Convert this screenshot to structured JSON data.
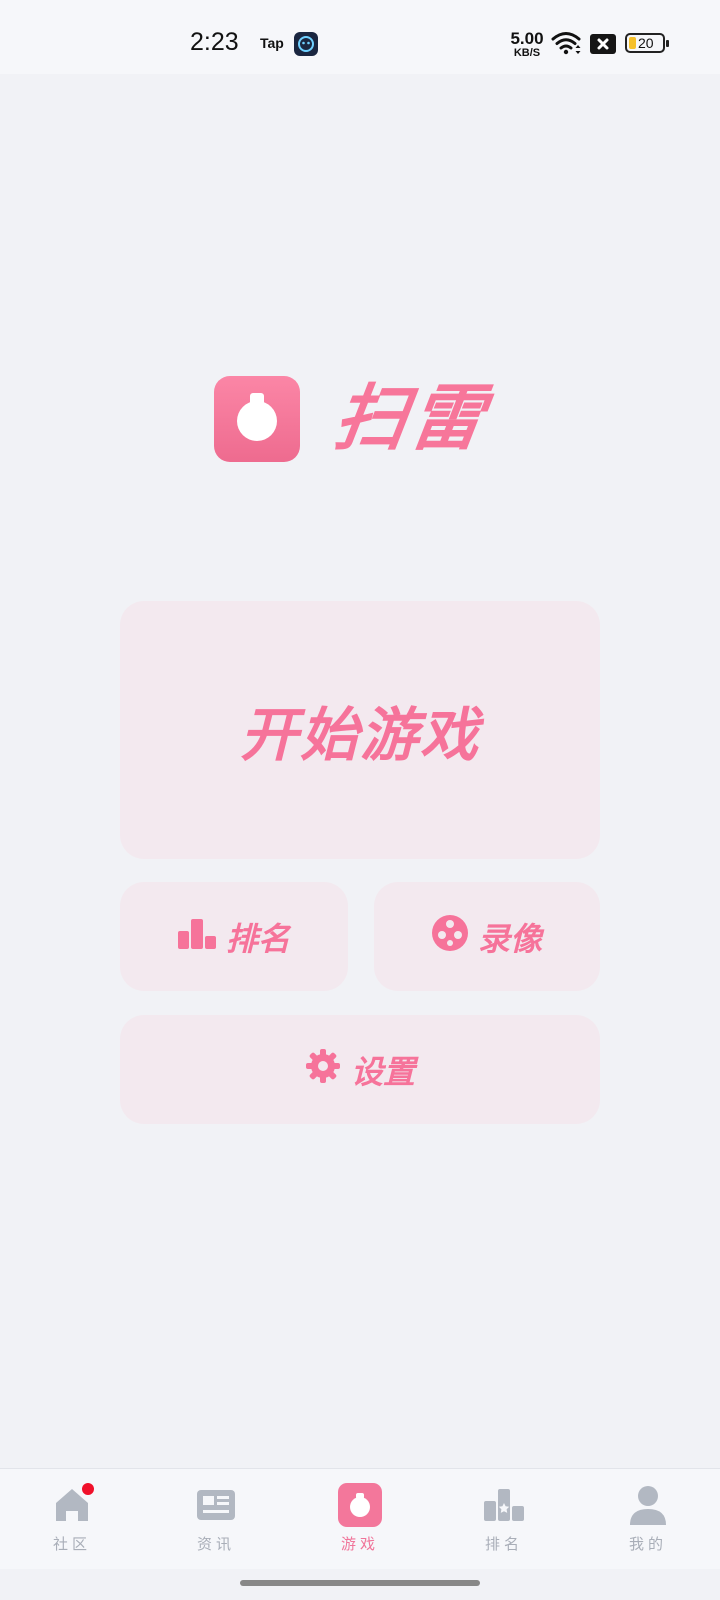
{
  "status_bar": {
    "time": "2:23",
    "app_label": "Tap",
    "net_speed_value": "5.00",
    "net_speed_unit": "KB/S",
    "battery_level": "20"
  },
  "header": {
    "title": "扫雷"
  },
  "menu": {
    "start_label": "开始游戏",
    "rank_label": "排名",
    "replay_label": "录像",
    "settings_label": "设置"
  },
  "bottom_nav": {
    "items": [
      {
        "label": "社区",
        "icon": "home-icon"
      },
      {
        "label": "资讯",
        "icon": "news-icon"
      },
      {
        "label": "游戏",
        "icon": "game-icon"
      },
      {
        "label": "排名",
        "icon": "ranking-icon"
      },
      {
        "label": "我的",
        "icon": "profile-icon"
      }
    ],
    "active_index": 2
  },
  "colors": {
    "accent": "#f6739a",
    "button_bg": "#f3e9ef",
    "background": "#f1f2f6",
    "nav_inactive": "#a9aeb8",
    "badge": "#f0102a"
  }
}
